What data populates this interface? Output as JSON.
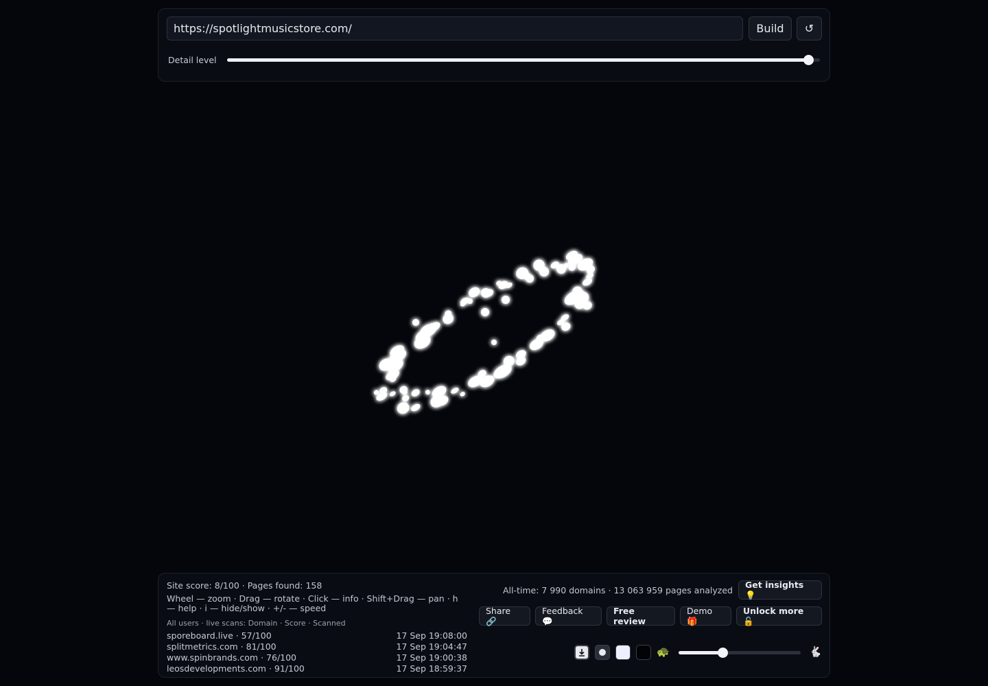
{
  "top": {
    "url_value": "https://spotlightmusicstore.com/",
    "build_label": "Build",
    "reload_icon": "↺",
    "detail_label": "Detail level",
    "detail_level": 0.98
  },
  "stats": {
    "site_score": "Site score: 8/100 · Pages found: 158",
    "help": "Wheel — zoom · Drag — rotate · Click — info · Shift+Drag — pan · h — help · i — hide/show · +/- — speed",
    "scans_header": "All users · live scans: Domain · Score · Scanned",
    "scans": [
      {
        "domain": "sporeboard.live · 57/100",
        "time": "17 Sep 19:08:00"
      },
      {
        "domain": "splitmetrics.com · 81/100",
        "time": "17 Sep 19:04:47"
      },
      {
        "domain": "www.spinbrands.com · 76/100",
        "time": "17 Sep 19:00:38"
      },
      {
        "domain": "leosdevelopments.com · 91/100",
        "time": "17 Sep 18:59:37"
      }
    ],
    "alltime": "All-time: 7 990 domains · 13 063 959 pages analyzed"
  },
  "actions": {
    "insights": "Get insights 💡",
    "share": "Share 🔗",
    "feedback": "Feedback 💬",
    "review": "Free review",
    "demo": "Demo 🎁",
    "unlock": "Unlock more 🔓"
  },
  "controls": {
    "speed_level": 0.36,
    "turtle": "🐢",
    "rabbit": "🐇",
    "download_icon": "download-icon",
    "swatch_light": "#eef0ff",
    "swatch_dark": "#020306"
  },
  "colors": {
    "background": "#04060b",
    "panel": "#090c13",
    "node": "#ffffff"
  }
}
